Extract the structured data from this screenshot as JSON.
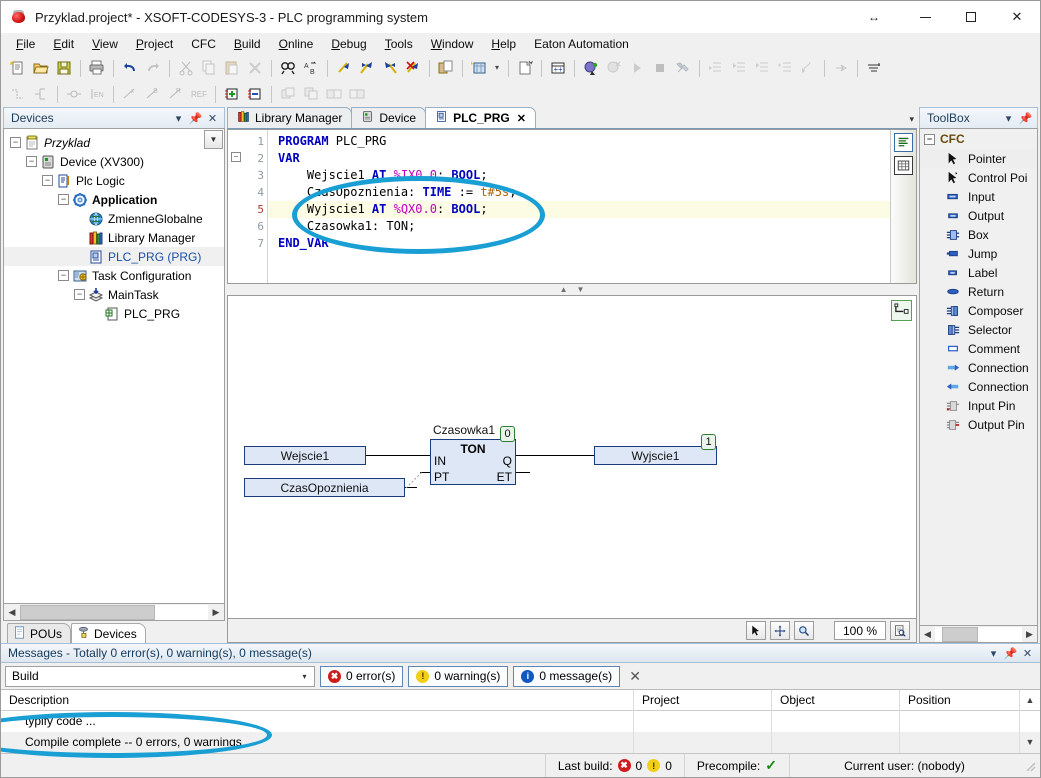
{
  "window": {
    "title": "Przyklad.project* - XSOFT-CODESYS-3 - PLC programming system",
    "icon": "codesys-red-dot-icon",
    "controls": {
      "resize": "↔",
      "minimize": "minimize-icon",
      "maximize": "maximize-icon",
      "close": "✕"
    }
  },
  "menubar": {
    "items": [
      {
        "label": "File"
      },
      {
        "label": "Edit"
      },
      {
        "label": "View"
      },
      {
        "label": "Project"
      },
      {
        "label": "CFC"
      },
      {
        "label": "Build"
      },
      {
        "label": "Online"
      },
      {
        "label": "Debug"
      },
      {
        "label": "Tools"
      },
      {
        "label": "Window"
      },
      {
        "label": "Help"
      },
      {
        "label": "Eaton Automation"
      }
    ]
  },
  "toolbar1": {
    "icons": [
      "new-file-icon",
      "open-folder-icon",
      "save-icon",
      "sep",
      "print-icon",
      "sep",
      "undo-icon",
      "redo-icon",
      "sep",
      "cut-icon",
      "copy-icon",
      "paste-icon",
      "delete-icon",
      "sep",
      "find-icon",
      "replace-icon",
      "sep",
      "bookmark-toggle-icon",
      "next-bookmark-icon",
      "prev-bookmark-icon",
      "clear-bookmarks-icon",
      "sep",
      "duplicate-icon",
      "sep",
      "new-object-icon",
      "object-dropdown-icon",
      "sep",
      "object-properties-icon",
      "sep",
      "build-icon",
      "sep",
      "login-icon",
      "logout-icon",
      "run-icon",
      "stop-icon",
      "debug-tools-icon",
      "sep",
      "step-over-icon",
      "step-into-icon",
      "step-out-icon",
      "run-to-cursor-icon",
      "set-next-icon",
      "sep",
      "next-statement-icon",
      "sep",
      "flow-control-icon"
    ]
  },
  "toolbar2": {
    "icons": [
      "network-after-icon",
      "branch-icon",
      "sep",
      "contact-icon",
      "en-block-icon",
      "sep",
      "negate-icon",
      "set-coil-icon",
      "reset-coil-icon",
      "ref-icon",
      "sep",
      "insert-input-icon",
      "remove-input-icon",
      "sep",
      "paste-above-icon",
      "paste-below-icon",
      "paste-right-icon",
      "paste-left-icon"
    ]
  },
  "devices_panel": {
    "title": "Devices",
    "header_buttons": [
      "dropdown-icon",
      "pin-icon",
      "close-icon"
    ],
    "tree": [
      {
        "label": "Przyklad",
        "depth": 0,
        "icon": "project-icon",
        "expander": "−",
        "style": "italic"
      },
      {
        "label": "Device (XV300)",
        "depth": 1,
        "icon": "device-icon",
        "expander": "−",
        "style": ""
      },
      {
        "label": "Plc Logic",
        "depth": 2,
        "icon": "plc-logic-icon",
        "expander": "−",
        "style": ""
      },
      {
        "label": "Application",
        "depth": 3,
        "icon": "application-icon",
        "expander": "−",
        "style": "bold"
      },
      {
        "label": "ZmienneGlobalne",
        "depth": 4,
        "icon": "gvl-globe-icon",
        "expander": "",
        "style": ""
      },
      {
        "label": "Library Manager",
        "depth": 4,
        "icon": "library-manager-icon",
        "expander": "",
        "style": ""
      },
      {
        "label": "PLC_PRG (PRG)",
        "depth": 4,
        "icon": "pou-icon",
        "expander": "",
        "style": "selected"
      },
      {
        "label": "Task Configuration",
        "depth": 3,
        "icon": "task-config-icon",
        "expander": "−",
        "style": ""
      },
      {
        "label": "MainTask",
        "depth": 4,
        "icon": "task-icon",
        "expander": "−",
        "style": ""
      },
      {
        "label": "PLC_PRG",
        "depth": 5,
        "icon": "task-pou-icon",
        "expander": "",
        "style": ""
      }
    ],
    "bottom_tabs": [
      {
        "label": "POUs",
        "icon": "pou-page-icon",
        "active": false
      },
      {
        "label": "Devices",
        "icon": "devices-icon",
        "active": true
      }
    ]
  },
  "editor": {
    "tabs": [
      {
        "label": "Library Manager",
        "icon": "library-manager-icon",
        "active": false,
        "closable": false
      },
      {
        "label": "Device",
        "icon": "device-icon",
        "active": false,
        "closable": false
      },
      {
        "label": "PLC_PRG",
        "icon": "pou-icon",
        "active": true,
        "closable": true,
        "close_label": "✕"
      }
    ],
    "tab_dropdown": "▾",
    "declaration": {
      "line_numbers": [
        "1",
        "2",
        "3",
        "4",
        "5",
        "6",
        "7"
      ],
      "current_line": 5,
      "lines": [
        {
          "n": 1,
          "tokens": [
            {
              "t": "PROGRAM ",
              "c": "kw"
            },
            {
              "t": "PLC_PRG",
              "c": "plain"
            }
          ]
        },
        {
          "n": 2,
          "tokens": [
            {
              "t": "VAR",
              "c": "kw"
            }
          ]
        },
        {
          "n": 3,
          "tokens": [
            {
              "t": "    Wejscie1 ",
              "c": "plain"
            },
            {
              "t": "AT ",
              "c": "kw"
            },
            {
              "t": "%IX0.0",
              "c": "adr"
            },
            {
              "t": ": ",
              "c": "plain"
            },
            {
              "t": "BOOL",
              "c": "kw"
            },
            {
              "t": ";",
              "c": "plain"
            }
          ]
        },
        {
          "n": 4,
          "tokens": [
            {
              "t": "    CzasOpoznienia: ",
              "c": "plain"
            },
            {
              "t": "TIME ",
              "c": "kw"
            },
            {
              "t": ":= ",
              "c": "plain"
            },
            {
              "t": "t#5s",
              "c": "lit"
            },
            {
              "t": ";",
              "c": "plain"
            }
          ]
        },
        {
          "n": 5,
          "tokens": [
            {
              "t": "    Wyjscie1 ",
              "c": "plain"
            },
            {
              "t": "AT ",
              "c": "kw"
            },
            {
              "t": "%QX0.0",
              "c": "adr"
            },
            {
              "t": ": ",
              "c": "plain"
            },
            {
              "t": "BOOL",
              "c": "kw"
            },
            {
              "t": ";",
              "c": "plain"
            }
          ]
        },
        {
          "n": 6,
          "tokens": [
            {
              "t": "    Czasowka1: ",
              "c": "plain"
            },
            {
              "t": "TON",
              "c": "plain"
            },
            {
              "t": ";",
              "c": "plain"
            }
          ]
        },
        {
          "n": 7,
          "tokens": [
            {
              "t": "END_VAR",
              "c": "kw"
            }
          ]
        }
      ],
      "side_buttons": [
        "textual-view-icon",
        "tabular-view-icon"
      ]
    },
    "cfc": {
      "tool_button": "connect-mode-icon",
      "blocks": {
        "instance_name": "Czasowka1",
        "type": "TON",
        "inputs": [
          "IN",
          "PT"
        ],
        "outputs": [
          "Q",
          "ET"
        ],
        "q_value": "0"
      },
      "variables": [
        {
          "name": "Wejscie1",
          "role": "input"
        },
        {
          "name": "CzasOpoznienia",
          "role": "input"
        },
        {
          "name": "Wyjscie1",
          "role": "output",
          "value": "1"
        }
      ]
    },
    "cfc_status": {
      "tools": [
        "pointer-icon",
        "pan-icon",
        "zoom-icon"
      ],
      "zoom_level": "100 %",
      "zoom_button": "zoom-preview-icon"
    }
  },
  "toolbox": {
    "title": "ToolBox",
    "header_buttons": [
      "dropdown-icon",
      "pin-icon"
    ],
    "group": "CFC",
    "group_expander": "−",
    "items": [
      {
        "label": "Pointer",
        "icon": "pointer-icon",
        "selected": true
      },
      {
        "label": "Control Poi",
        "icon": "control-point-icon",
        "selected": false
      },
      {
        "label": "Input",
        "icon": "input-icon",
        "selected": false
      },
      {
        "label": "Output",
        "icon": "output-icon",
        "selected": false
      },
      {
        "label": "Box",
        "icon": "box-icon",
        "selected": false
      },
      {
        "label": "Jump",
        "icon": "jump-icon",
        "selected": false
      },
      {
        "label": "Label",
        "icon": "label-icon",
        "selected": false
      },
      {
        "label": "Return",
        "icon": "return-icon",
        "selected": false
      },
      {
        "label": "Composer",
        "icon": "composer-icon",
        "selected": false
      },
      {
        "label": "Selector",
        "icon": "selector-icon",
        "selected": false
      },
      {
        "label": "Comment",
        "icon": "comment-icon",
        "selected": false
      },
      {
        "label": "Connection",
        "icon": "connection-mark-source-icon",
        "selected": false
      },
      {
        "label": "Connection",
        "icon": "connection-mark-sink-icon",
        "selected": false
      },
      {
        "label": "Input Pin",
        "icon": "input-pin-icon",
        "selected": false
      },
      {
        "label": "Output Pin",
        "icon": "output-pin-icon",
        "selected": false
      }
    ]
  },
  "messages": {
    "title": "Messages - Totally 0 error(s), 0 warning(s), 0 message(s)",
    "header_buttons": [
      "dropdown-icon",
      "pin-icon",
      "close-icon"
    ],
    "filter_value": "Build",
    "chips": [
      {
        "label": "0 error(s)",
        "type": "err",
        "glyph": "✖"
      },
      {
        "label": "0 warning(s)",
        "type": "warn",
        "glyph": "!"
      },
      {
        "label": "0 message(s)",
        "type": "info",
        "glyph": "i"
      }
    ],
    "clear_button": "✕",
    "columns": [
      "Description",
      "Project",
      "Object",
      "Position"
    ],
    "rows": [
      {
        "description": "typify code ...",
        "project": "",
        "object": "",
        "position": ""
      },
      {
        "description": "Compile complete -- 0 errors, 0 warnings",
        "project": "",
        "object": "",
        "position": ""
      }
    ]
  },
  "statusbar": {
    "last_build_label": "Last build:",
    "errors": "0",
    "warnings": "0",
    "precompile_label": "Precompile:",
    "precompile_state": "✓",
    "user_label": "Current user: (nobody)"
  },
  "annotations": {
    "color": "#1a9fd4",
    "ellipses": [
      {
        "name": "var-decl-highlight"
      },
      {
        "name": "compile-complete-highlight"
      }
    ]
  }
}
